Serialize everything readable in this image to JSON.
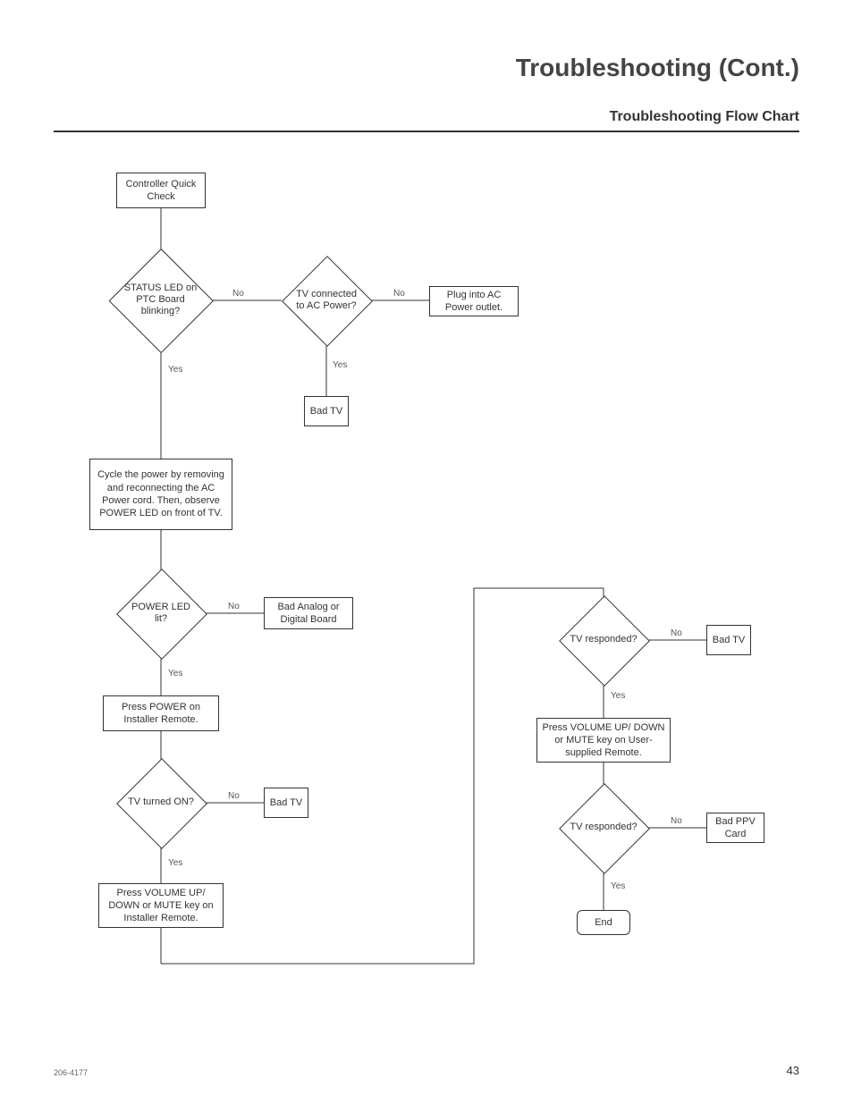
{
  "header": {
    "title": "Troubleshooting (Cont.)",
    "subtitle": "Troubleshooting Flow Chart"
  },
  "footer": {
    "docnum": "206-4177",
    "pagenum": "43"
  },
  "nodes": {
    "start": "Controller\nQuick Check",
    "d_status": "STATUS\nLED on PTC\nBoard\nblinking?",
    "d_ac": "TV\nconnected\nto AC\nPower?",
    "plug": "Plug into AC\nPower outlet.",
    "badtv1": "Bad\nTV",
    "cycle": "Cycle the power by\nremoving and reconnecting\nthe AC Power cord. Then,\nobserve POWER LED\non front of TV.",
    "d_power": "POWER\nLED lit?",
    "badboard": "Bad Analog or\nDigital Board",
    "presspower": "Press POWER on\nInstaller Remote.",
    "d_turnedon": "TV\nturned ON?",
    "badtv2": "Bad\nTV",
    "pressvol1": "Press VOLUME UP/\nDOWN or MUTE key\non Installer Remote.",
    "d_resp1": "TV\nresponded?",
    "badtv3": "Bad\nTV",
    "pressvol2": "Press VOLUME UP/\nDOWN or MUTE key on\nUser-supplied Remote.",
    "d_resp2": "TV\nresponded?",
    "badppv": "Bad\nPPV Card",
    "end": "End"
  },
  "labels": {
    "yes": "Yes",
    "no": "No"
  },
  "chart_data": {
    "type": "flowchart",
    "nodes": [
      {
        "id": "start",
        "type": "process",
        "text": "Controller Quick Check"
      },
      {
        "id": "d_status",
        "type": "decision",
        "text": "STATUS LED on PTC Board blinking?"
      },
      {
        "id": "d_ac",
        "type": "decision",
        "text": "TV connected to AC Power?"
      },
      {
        "id": "plug",
        "type": "process",
        "text": "Plug into AC Power outlet."
      },
      {
        "id": "badtv1",
        "type": "terminal",
        "text": "Bad TV"
      },
      {
        "id": "cycle",
        "type": "process",
        "text": "Cycle the power by removing and reconnecting the AC Power cord. Then, observe POWER LED on front of TV."
      },
      {
        "id": "d_power",
        "type": "decision",
        "text": "POWER LED lit?"
      },
      {
        "id": "badboard",
        "type": "terminal",
        "text": "Bad Analog or Digital Board"
      },
      {
        "id": "presspower",
        "type": "process",
        "text": "Press POWER on Installer Remote."
      },
      {
        "id": "d_turnedon",
        "type": "decision",
        "text": "TV turned ON?"
      },
      {
        "id": "badtv2",
        "type": "terminal",
        "text": "Bad TV"
      },
      {
        "id": "pressvol1",
        "type": "process",
        "text": "Press VOLUME UP/DOWN or MUTE key on Installer Remote."
      },
      {
        "id": "d_resp1",
        "type": "decision",
        "text": "TV responded?"
      },
      {
        "id": "badtv3",
        "type": "terminal",
        "text": "Bad TV"
      },
      {
        "id": "pressvol2",
        "type": "process",
        "text": "Press VOLUME UP/DOWN or MUTE key on User-supplied Remote."
      },
      {
        "id": "d_resp2",
        "type": "decision",
        "text": "TV responded?"
      },
      {
        "id": "badppv",
        "type": "terminal",
        "text": "Bad PPV Card"
      },
      {
        "id": "end",
        "type": "terminal",
        "text": "End"
      }
    ],
    "edges": [
      {
        "from": "start",
        "to": "d_status"
      },
      {
        "from": "d_status",
        "to": "d_ac",
        "label": "No"
      },
      {
        "from": "d_status",
        "to": "cycle",
        "label": "Yes"
      },
      {
        "from": "d_ac",
        "to": "plug",
        "label": "No"
      },
      {
        "from": "d_ac",
        "to": "badtv1",
        "label": "Yes"
      },
      {
        "from": "cycle",
        "to": "d_power"
      },
      {
        "from": "d_power",
        "to": "badboard",
        "label": "No"
      },
      {
        "from": "d_power",
        "to": "presspower",
        "label": "Yes"
      },
      {
        "from": "presspower",
        "to": "d_turnedon"
      },
      {
        "from": "d_turnedon",
        "to": "badtv2",
        "label": "No"
      },
      {
        "from": "d_turnedon",
        "to": "pressvol1",
        "label": "Yes"
      },
      {
        "from": "pressvol1",
        "to": "d_resp1"
      },
      {
        "from": "d_resp1",
        "to": "badtv3",
        "label": "No"
      },
      {
        "from": "d_resp1",
        "to": "pressvol2",
        "label": "Yes"
      },
      {
        "from": "pressvol2",
        "to": "d_resp2"
      },
      {
        "from": "d_resp2",
        "to": "badppv",
        "label": "No"
      },
      {
        "from": "d_resp2",
        "to": "end",
        "label": "Yes"
      }
    ]
  }
}
